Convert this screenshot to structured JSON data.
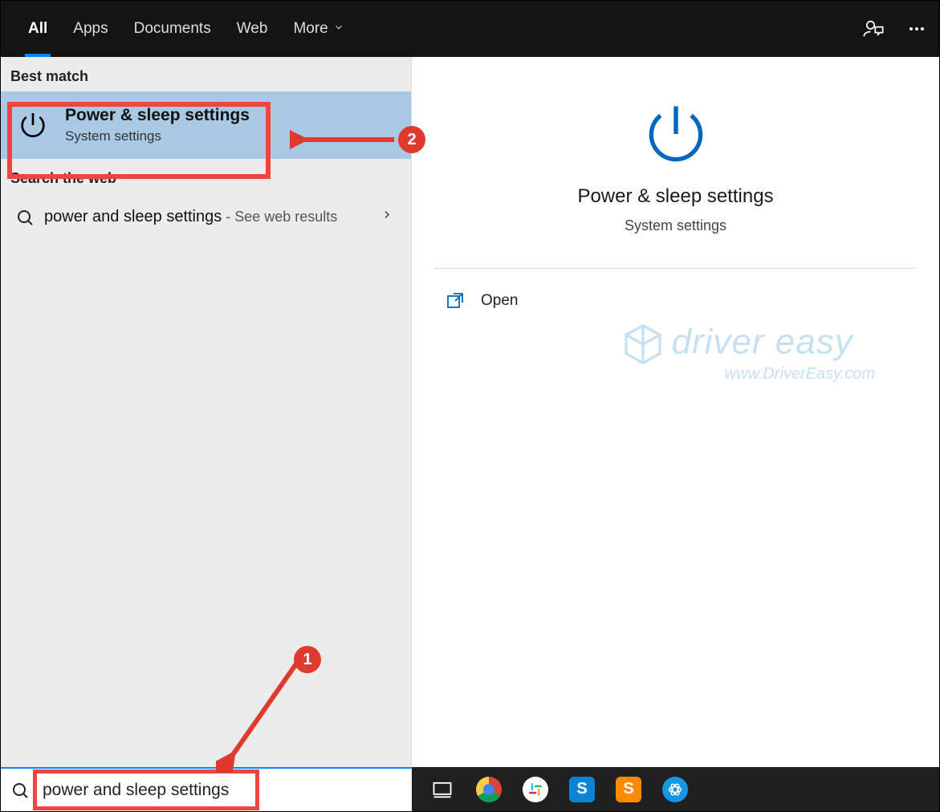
{
  "tabs": {
    "all": "All",
    "apps": "Apps",
    "documents": "Documents",
    "web": "Web",
    "more": "More"
  },
  "left": {
    "best_match_label": "Best match",
    "best_match": {
      "title": "Power & sleep settings",
      "subtitle": "System settings"
    },
    "search_web_label": "Search the web",
    "web_result": {
      "query": "power and sleep settings",
      "suffix": " - See web results"
    }
  },
  "right": {
    "title": "Power & sleep settings",
    "subtitle": "System settings",
    "open_label": "Open"
  },
  "watermark": {
    "name": "driver easy",
    "url": "www.DriverEasy.com"
  },
  "search": {
    "value": "power and sleep settings"
  },
  "annotations": {
    "step1": "1",
    "step2": "2"
  }
}
